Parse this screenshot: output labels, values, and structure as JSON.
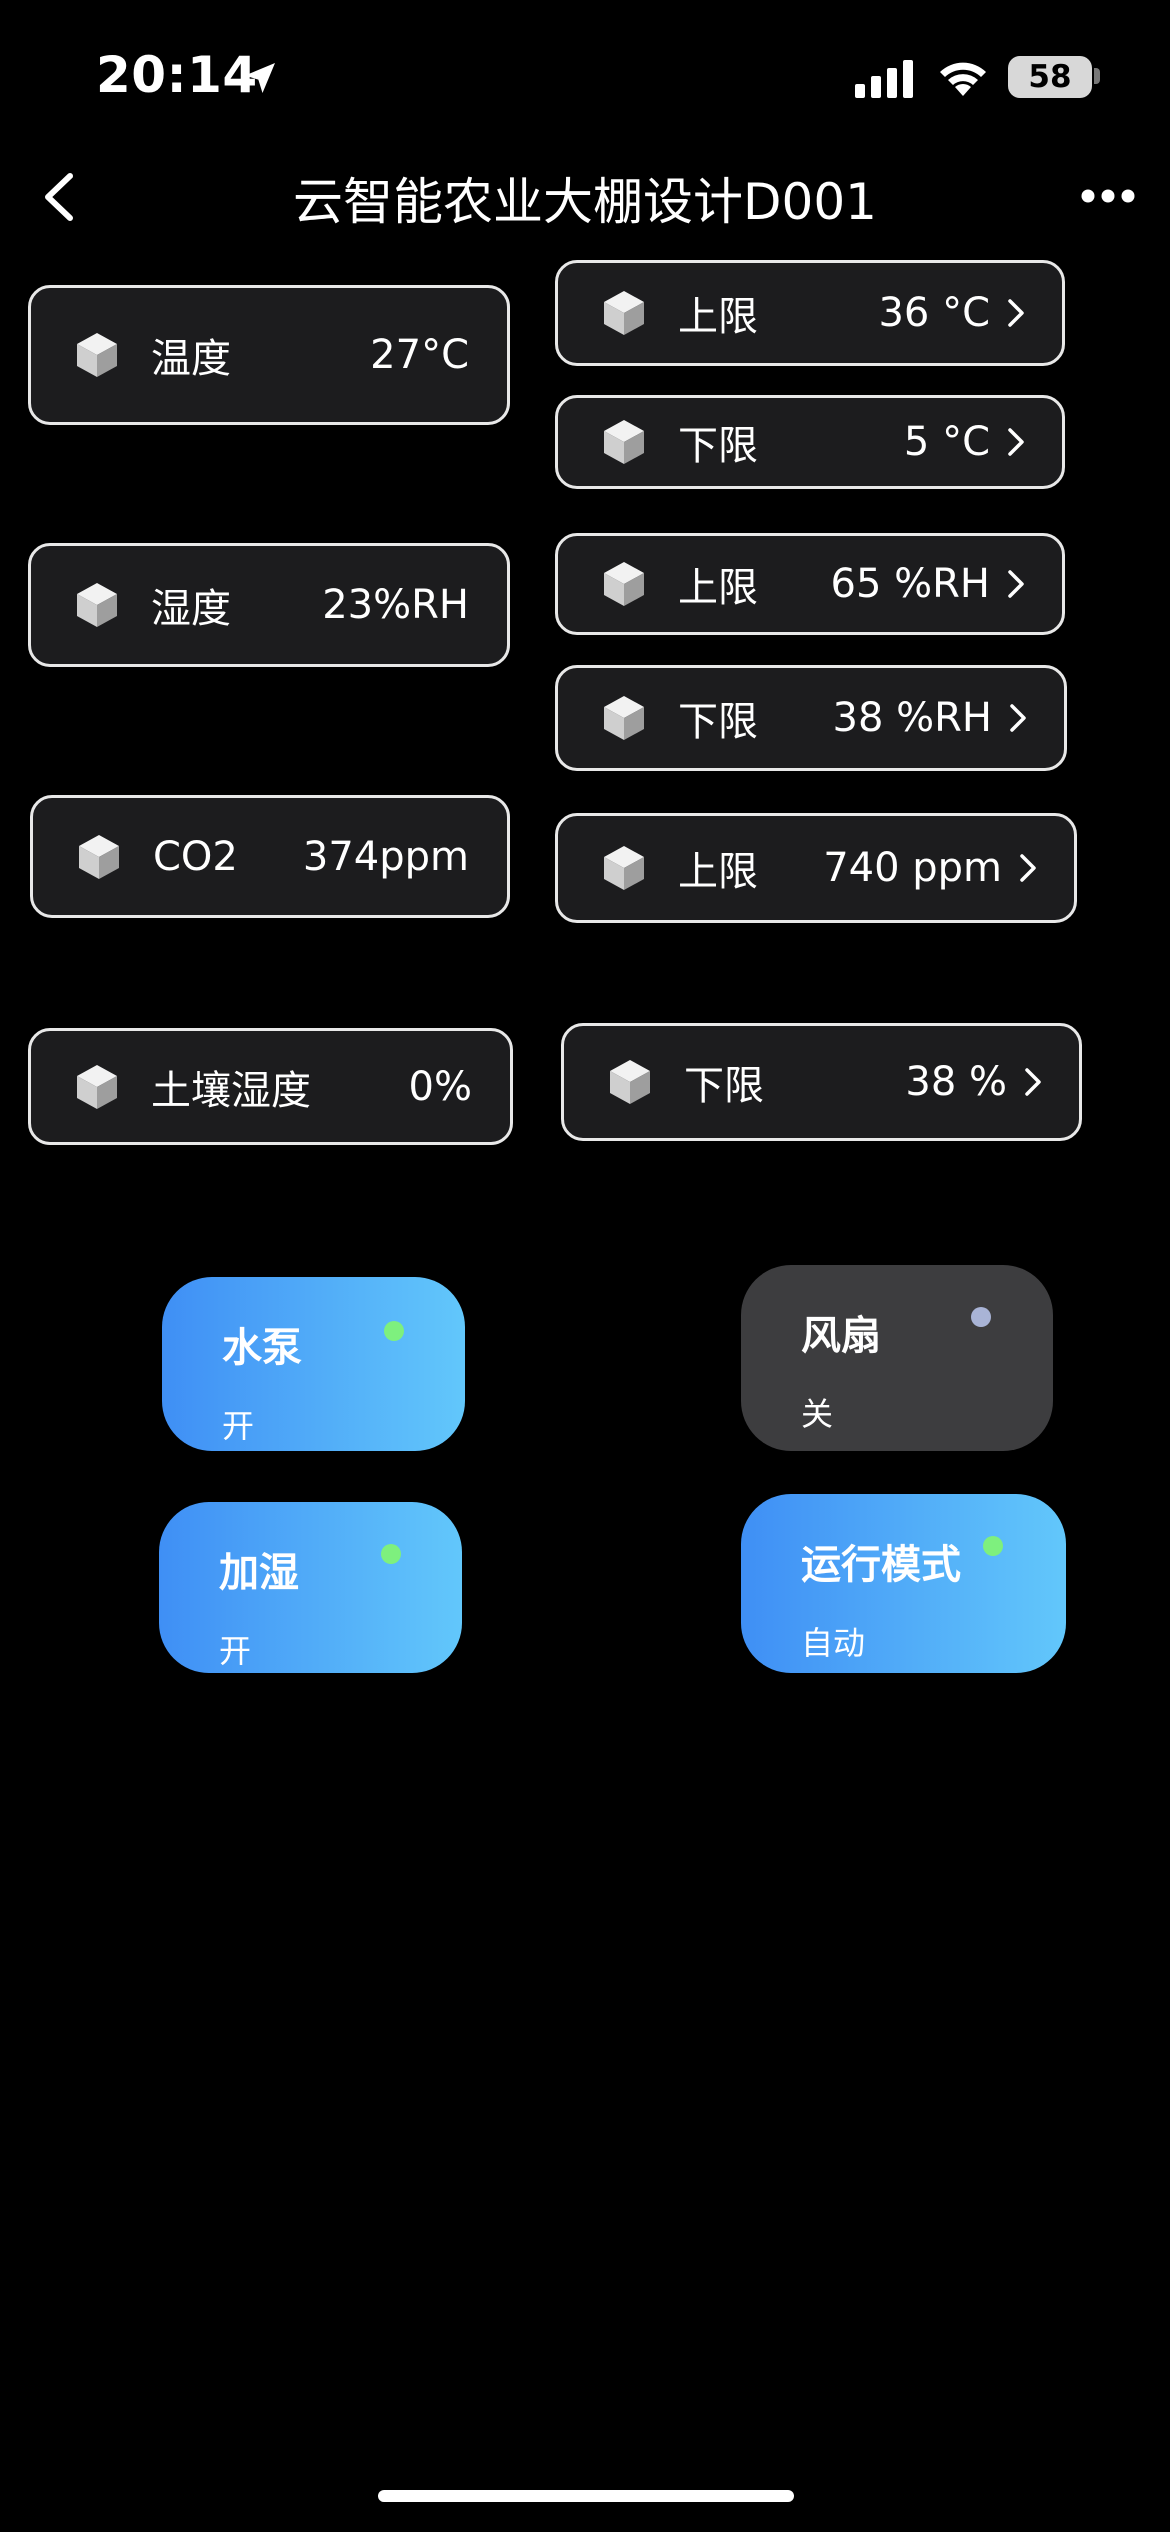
{
  "status": {
    "time": "20:14",
    "battery": "58"
  },
  "header": {
    "title": "云智能农业大棚设计D001"
  },
  "icons": {
    "back": "chevron-left-icon",
    "more": "more-horizontal-icon",
    "sensor": "cube-icon",
    "limit_arrow": "chevron-right-icon",
    "location": "location-arrow-icon",
    "signal": "cellular-signal-icon",
    "wifi": "wifi-icon"
  },
  "sensors": {
    "temperature": {
      "label": "温度",
      "value": "27°C"
    },
    "humidity": {
      "label": "湿度",
      "value": "23%RH"
    },
    "co2": {
      "label": "CO2",
      "value": "374ppm"
    },
    "soil": {
      "label": "土壤湿度",
      "value": "0%"
    }
  },
  "limits": {
    "temp_upper": {
      "label": "上限",
      "value": "36 °C"
    },
    "temp_lower": {
      "label": "下限",
      "value": "5 °C"
    },
    "hum_upper": {
      "label": "上限",
      "value": "65 %RH"
    },
    "hum_lower": {
      "label": "下限",
      "value": "38 %RH"
    },
    "co2_upper": {
      "label": "上限",
      "value": "740 ppm"
    },
    "soil_lower": {
      "label": "下限",
      "value": "38 %"
    }
  },
  "controls": {
    "pump": {
      "name": "水泵",
      "state": "开"
    },
    "fan": {
      "name": "风扇",
      "state": "关"
    },
    "humidify": {
      "name": "加湿",
      "state": "开"
    },
    "mode": {
      "name": "运行模式",
      "state": "自动"
    }
  },
  "colors": {
    "tile_on_start": "#3f8ff5",
    "tile_on_end": "#62c7fb",
    "tile_off": "#3d3d3f",
    "dot_on": "#7ef07e",
    "dot_off": "#a9b4d6",
    "card_bg": "#1c1c1e",
    "card_border": "#e8e8e8"
  }
}
